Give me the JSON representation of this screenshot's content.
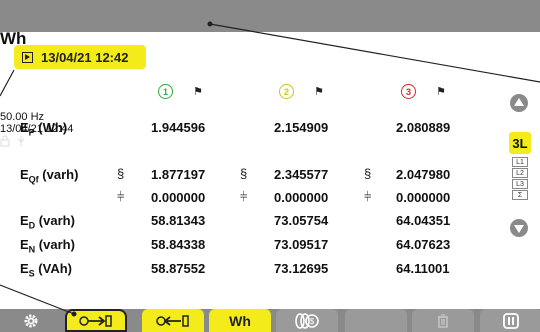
{
  "header": {
    "title": "Wh",
    "help_label": "?",
    "frequency": "50.00 Hz",
    "datetime": "13/04/21 12:44"
  },
  "snapshot": {
    "datetime": "13/04/21 12:42"
  },
  "phases": [
    {
      "number": "1",
      "color": "#2fa83a"
    },
    {
      "number": "2",
      "color": "#d4c21a"
    },
    {
      "number": "3",
      "color": "#d8262b"
    }
  ],
  "rows": {
    "ep": {
      "label": "E",
      "sub": "P",
      "unit": " (Wh)",
      "values": [
        "1.944596",
        "2.154909",
        "2.080889"
      ]
    },
    "eqf1": {
      "label": "E",
      "sub": "Qf",
      "unit": " (varh)",
      "values": [
        "1.877197",
        "2.345577",
        "2.047980"
      ]
    },
    "eqf2": {
      "values": [
        "0.000000",
        "0.000000",
        "0.000000"
      ]
    },
    "ed": {
      "label": "E",
      "sub": "D",
      "unit": " (varh)",
      "values": [
        "58.81343",
        "73.05754",
        "64.04351"
      ]
    },
    "en": {
      "label": "E",
      "sub": "N",
      "unit": " (varh)",
      "values": [
        "58.84338",
        "73.09517",
        "64.07623"
      ]
    },
    "es": {
      "label": "E",
      "sub": "S",
      "unit": " (VAh)",
      "values": [
        "58.87552",
        "73.12695",
        "64.11001"
      ]
    }
  },
  "side": {
    "selected": "3L",
    "options": [
      "L1",
      "L2",
      "L3",
      "Σ"
    ]
  },
  "toolbar": {
    "wh_label": "Wh"
  },
  "colors": {
    "accent": "#f3ec1a",
    "bar": "#8a8a8a"
  }
}
